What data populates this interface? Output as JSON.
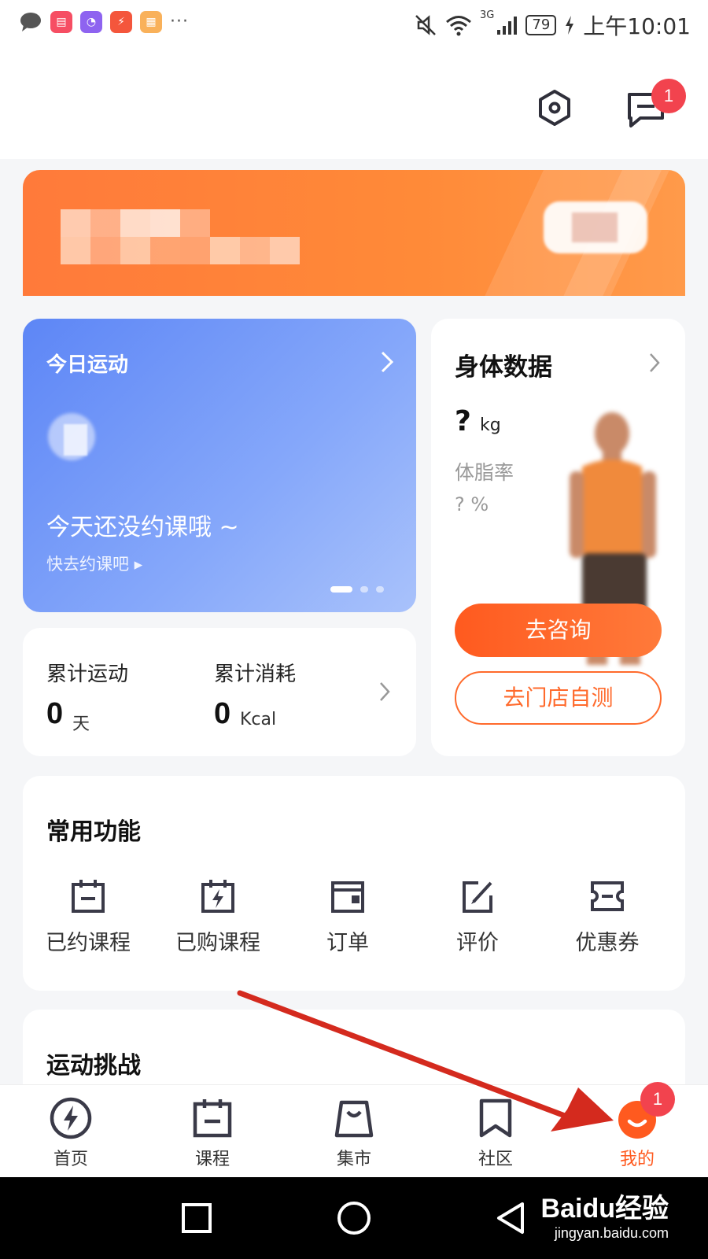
{
  "status_bar": {
    "battery": "79",
    "time": "上午10:01",
    "network": "3G",
    "more": "···"
  },
  "header": {
    "message_badge": "1"
  },
  "today_card": {
    "title": "今日运动",
    "message": "今天还没约课哦 ~",
    "cta": "快去约课吧 ▸"
  },
  "totals_card": {
    "exercise_label": "累计运动",
    "exercise_value": "0",
    "exercise_unit": "天",
    "burn_label": "累计消耗",
    "burn_value": "0",
    "burn_unit": "Kcal"
  },
  "body_card": {
    "title": "身体数据",
    "weight_value": "?",
    "weight_unit": "kg",
    "fat_label": "体脂率",
    "fat_value": "? %",
    "consult_button": "去咨询",
    "store_button": "去门店自测"
  },
  "common_functions": {
    "title": "常用功能",
    "items": [
      {
        "label": "已约课程",
        "icon": "calendar-icon"
      },
      {
        "label": "已购课程",
        "icon": "bolt-calendar-icon"
      },
      {
        "label": "订单",
        "icon": "wallet-icon"
      },
      {
        "label": "评价",
        "icon": "edit-icon"
      },
      {
        "label": "优惠券",
        "icon": "ticket-icon"
      }
    ]
  },
  "challenge": {
    "title": "运动挑战"
  },
  "tab_bar": {
    "items": [
      {
        "label": "首页",
        "icon": "lightning-icon"
      },
      {
        "label": "课程",
        "icon": "calendar-icon"
      },
      {
        "label": "集市",
        "icon": "bag-icon"
      },
      {
        "label": "社区",
        "icon": "bookmark-icon"
      },
      {
        "label": "我的",
        "icon": "smile-avatar-icon",
        "active": true,
        "badge": "1"
      }
    ]
  },
  "watermark": {
    "brand": "Baidu经验",
    "url": "jingyan.baidu.com"
  },
  "colors": {
    "accent": "#ff5a1f",
    "banner": "#ff8a38",
    "today_card": "#6f95f8",
    "badge": "#f2434e",
    "arrow": "#d42a1e"
  }
}
